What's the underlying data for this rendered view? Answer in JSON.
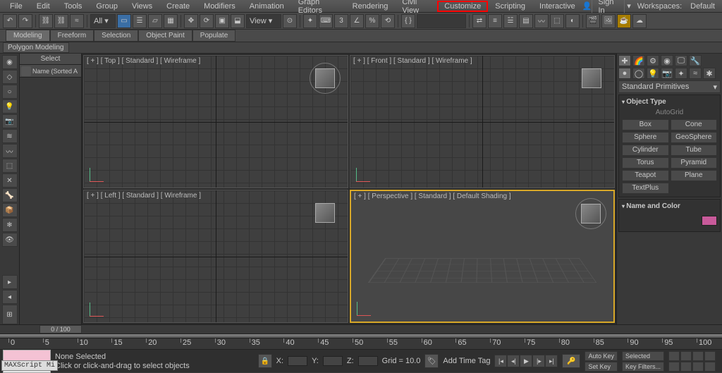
{
  "menu": {
    "items": [
      "File",
      "Edit",
      "Tools",
      "Group",
      "Views",
      "Create",
      "Modifiers",
      "Animation",
      "Graph Editors",
      "Rendering",
      "Civil View",
      "Customize",
      "Scripting",
      "Interactive"
    ],
    "highlighted": "Customize",
    "signin": "Sign In",
    "workspaces_label": "Workspaces:",
    "workspaces_value": "Default"
  },
  "toolbar1": {
    "all_filter": "All",
    "view_dd": "View"
  },
  "ribbon": {
    "tabs": [
      "Modeling",
      "Freeform",
      "Selection",
      "Object Paint",
      "Populate"
    ],
    "active": 0,
    "sub": "Polygon Modeling"
  },
  "scene_explorer": {
    "header": "Select",
    "search_placeholder": "Name (Sorted A"
  },
  "viewports": {
    "top": "[ + ] [ Top ] [ Standard ] [ Wireframe ]",
    "front": "[ + ] [ Front ] [ Standard ] [ Wireframe ]",
    "left": "[ + ] [ Left ] [ Standard ] [ Wireframe ]",
    "persp": "[ + ] [ Perspective ] [ Standard ] [ Default Shading ]"
  },
  "command_panel": {
    "dropdown": "Standard Primitives",
    "object_type_title": "Object Type",
    "autogrid": "AutoGrid",
    "primitives": [
      "Box",
      "Cone",
      "Sphere",
      "GeoSphere",
      "Cylinder",
      "Tube",
      "Torus",
      "Pyramid",
      "Teapot",
      "Plane",
      "TextPlus"
    ],
    "name_color_title": "Name and Color",
    "swatch": "#c85a9a"
  },
  "time": {
    "slider": "0 / 100",
    "ticks": [
      0,
      5,
      10,
      15,
      20,
      25,
      30,
      35,
      40,
      45,
      50,
      55,
      60,
      65,
      70,
      75,
      80,
      85,
      90,
      95,
      100
    ]
  },
  "status": {
    "selection": "None Selected",
    "hint": "Click or click-and-drag to select objects",
    "x": "X:",
    "y": "Y:",
    "z": "Z:",
    "grid": "Grid = 10.0",
    "add_time_tag": "Add Time Tag",
    "autokey": "Auto Key",
    "setkey": "Set Key",
    "selected_dd": "Selected",
    "keyfilters": "Key Filters...",
    "maxscript": "MAXScript Mi"
  }
}
